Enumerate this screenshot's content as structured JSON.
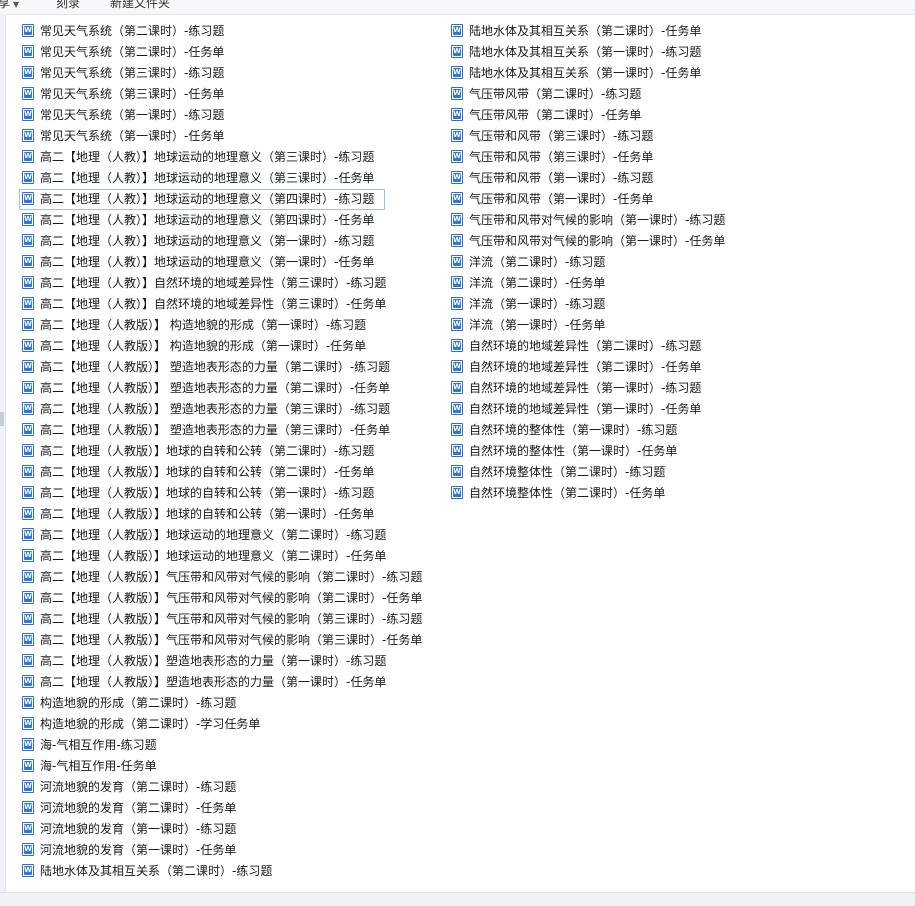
{
  "toolbar": {
    "share_label": "享",
    "copy_label": "刻录",
    "new_folder_label": "新建文件夹"
  },
  "icons": {
    "file_icon": "word-document-icon",
    "accent_color": "#3277d4"
  },
  "files": {
    "column_1": [
      "常见天气系统（第二课时）-练习题",
      "常见天气系统（第二课时）-任务单",
      "常见天气系统（第三课时）-练习题",
      "常见天气系统（第三课时）-任务单",
      "常见天气系统（第一课时）-练习题",
      "常见天气系统（第一课时）-任务单",
      "高二【地理（人教）】地球运动的地理意义（第三课时）-练习题",
      "高二【地理（人教）】地球运动的地理意义（第三课时）-任务单",
      "高二【地理（人教）】地球运动的地理意义（第四课时）-练习题",
      "高二【地理（人教）】地球运动的地理意义（第四课时）-任务单",
      "高二【地理（人教）】地球运动的地理意义（第一课时）-练习题",
      "高二【地理（人教）】地球运动的地理意义（第一课时）-任务单",
      "高二【地理（人教）】自然环境的地域差异性（第三课时）-练习题",
      "高二【地理（人教）】自然环境的地域差异性（第三课时）-任务单",
      "高二【地理（人教版）】 构造地貌的形成（第一课时）-练习题",
      "高二【地理（人教版）】 构造地貌的形成（第一课时）-任务单",
      "高二【地理（人教版）】 塑造地表形态的力量（第二课时）-练习题",
      "高二【地理（人教版）】 塑造地表形态的力量（第二课时）-任务单",
      "高二【地理（人教版）】 塑造地表形态的力量（第三课时）-练习题",
      "高二【地理（人教版）】 塑造地表形态的力量（第三课时）-任务单",
      "高二【地理（人教版）】地球的自转和公转（第二课时）-练习题",
      "高二【地理（人教版）】地球的自转和公转（第二课时）-任务单",
      "高二【地理（人教版）】地球的自转和公转（第一课时）-练习题",
      "高二【地理（人教版）】地球的自转和公转（第一课时）-任务单",
      "高二【地理（人教版）】地球运动的地理意义（第二课时）-练习题",
      "高二【地理（人教版）】地球运动的地理意义（第二课时）-任务单",
      "高二【地理（人教版）】气压带和风带对气候的影响（第二课时）-练习题",
      "高二【地理（人教版）】气压带和风带对气候的影响（第二课时）-任务单",
      "高二【地理（人教版）】气压带和风带对气候的影响（第三课时）-练习题",
      "高二【地理（人教版）】气压带和风带对气候的影响（第三课时）-任务单",
      "高二【地理（人教版）】塑造地表形态的力量（第一课时）-练习题",
      "高二【地理（人教版）】塑造地表形态的力量（第一课时）-任务单",
      "构造地貌的形成（第二课时）-练习题",
      "构造地貌的形成（第二课时）-学习任务单",
      "海-气相互作用-练习题",
      "海-气相互作用-任务单",
      "河流地貌的发育（第二课时）-练习题",
      "河流地貌的发育（第二课时）-任务单",
      "河流地貌的发育（第一课时）-练习题",
      "河流地貌的发育（第一课时）-任务单",
      "陆地水体及其相互关系（第二课时）-练习题"
    ],
    "column_2": [
      "陆地水体及其相互关系（第二课时）-任务单",
      "陆地水体及其相互关系（第一课时）-练习题",
      "陆地水体及其相互关系（第一课时）-任务单",
      "气压带风带（第二课时）-练习题",
      "气压带风带（第二课时）-任务单",
      "气压带和风带（第三课时）-练习题",
      "气压带和风带（第三课时）-任务单",
      "气压带和风带（第一课时）-练习题",
      "气压带和风带（第一课时）-任务单",
      "气压带和风带对气候的影响（第一课时）-练习题",
      "气压带和风带对气候的影响（第一课时）-任务单",
      "洋流（第二课时）-练习题",
      "洋流（第二课时）-任务单",
      "洋流（第一课时）-练习题",
      "洋流（第一课时）-任务单",
      "自然环境的地域差异性（第二课时）-练习题",
      "自然环境的地域差异性（第二课时）-任务单",
      "自然环境的地域差异性（第一课时）-练习题",
      "自然环境的地域差异性（第一课时）-任务单",
      "自然环境的整体性（第一课时）-练习题",
      "自然环境的整体性（第一课时）-任务单",
      "自然环境整体性（第二课时）-练习题",
      "自然环境整体性（第二课时）-任务单"
    ]
  }
}
